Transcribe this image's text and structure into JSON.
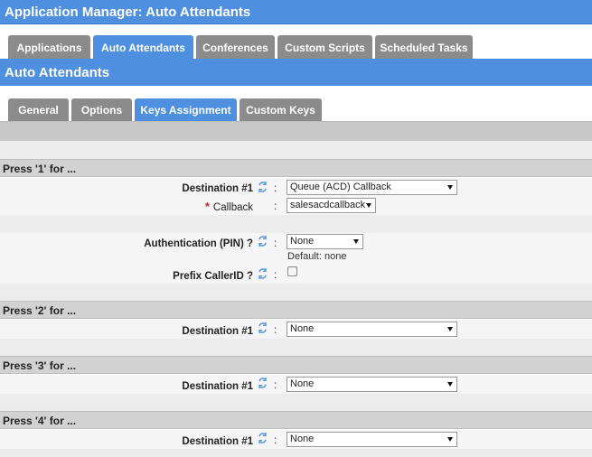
{
  "window": {
    "title": "Application Manager:  Auto Attendants"
  },
  "top_tabs": [
    {
      "label": "Applications",
      "active": false
    },
    {
      "label": "Auto Attendants",
      "active": true
    },
    {
      "label": "Conferences",
      "active": false
    },
    {
      "label": "Custom Scripts",
      "active": false
    },
    {
      "label": "Scheduled Tasks",
      "active": false
    }
  ],
  "section_title": "Auto Attendants",
  "sub_tabs": [
    {
      "label": "General",
      "active": false
    },
    {
      "label": "Options",
      "active": false
    },
    {
      "label": "Keys Assignment",
      "active": true
    },
    {
      "label": "Custom Keys",
      "active": false
    }
  ],
  "colors": {
    "accent": "#4f8fe0",
    "tab_inactive": "#8b8b8b",
    "required": "#c0282d"
  },
  "icons": {
    "refresh": "sync-arrows-icon",
    "dropdown": "chevron-down-icon"
  },
  "keys": [
    {
      "heading": "Press '1' for ...",
      "destination_label": "Destination #1",
      "destination_value": "Queue (ACD) Callback",
      "callback_label": "Callback",
      "callback_value": "salesacdcallback",
      "auth_label": "Authentication (PIN) ?",
      "auth_value": "None",
      "auth_default": "Default: none",
      "prefix_label": "Prefix CallerID ?",
      "prefix_checked": false
    },
    {
      "heading": "Press '2' for ...",
      "destination_label": "Destination #1",
      "destination_value": "None"
    },
    {
      "heading": "Press '3' for ...",
      "destination_label": "Destination #1",
      "destination_value": "None"
    },
    {
      "heading": "Press '4' for ...",
      "destination_label": "Destination #1",
      "destination_value": "None"
    }
  ],
  "separator": ":"
}
